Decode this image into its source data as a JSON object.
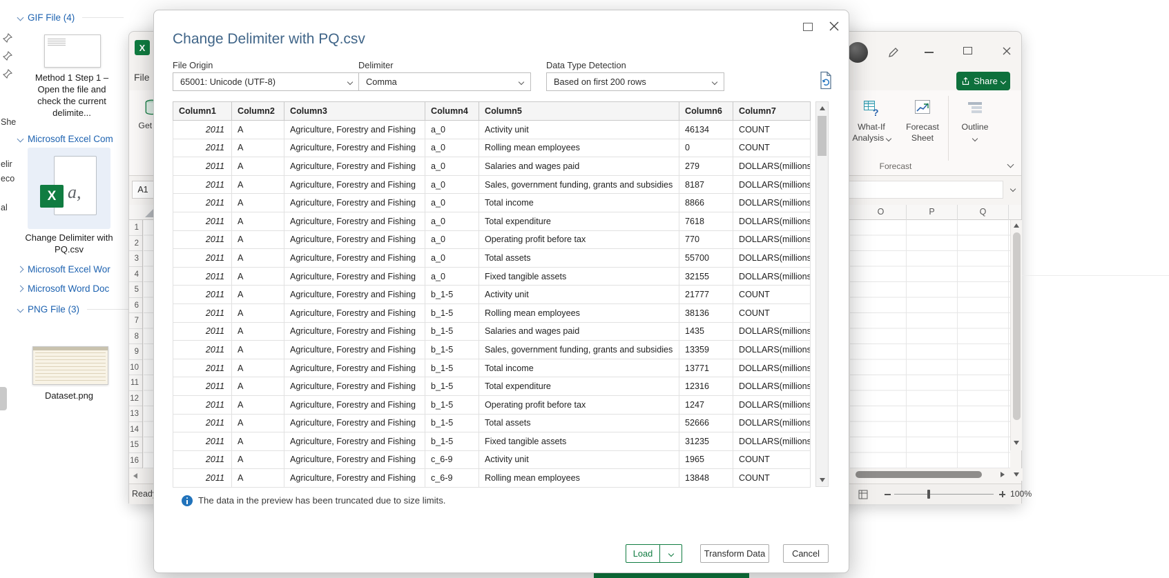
{
  "colors": {
    "excel_green": "#107C41",
    "share_green": "#0E703C",
    "dialog_title_blue": "#406588",
    "info_blue": "#2173BB",
    "explorer_link_blue": "#1D62B0"
  },
  "icon_glyphs": {
    "excel_x": "X",
    "csv_a": "a,"
  },
  "explorer": {
    "rail_fragments": [
      "She",
      "elir",
      "eco",
      "al"
    ],
    "groups": [
      {
        "label": "GIF File (4)",
        "state": "expanded"
      },
      {
        "label": "Microsoft Excel Com",
        "state": "expanded"
      },
      {
        "label": "Microsoft Excel Wor",
        "state": "collapsed"
      },
      {
        "label": "Microsoft Word Doc",
        "state": "collapsed"
      },
      {
        "label": "PNG File (3)",
        "state": "expanded"
      }
    ],
    "items": [
      {
        "name": "Method 1 Step 1 – Open the file and check the current delimite..."
      },
      {
        "name": "Change Delimiter with PQ.csv"
      },
      {
        "name": "Dataset.png"
      }
    ]
  },
  "excel": {
    "file_menu": "File",
    "get_data": "Get Data",
    "name_box": "A1",
    "share": "Share",
    "ribbon": {
      "what_if_1": "What-If",
      "what_if_2": "Analysis",
      "forecast_sheet_1": "Forecast",
      "forecast_sheet_2": "Sheet",
      "outline": "Outline",
      "group_label": "Forecast"
    },
    "column_headers": [
      "O",
      "P",
      "Q"
    ],
    "row_numbers": [
      "1",
      "2",
      "3",
      "4",
      "5",
      "6",
      "7",
      "8",
      "9",
      "10",
      "11",
      "12",
      "13",
      "14",
      "15",
      "16"
    ],
    "status": "Ready",
    "zoom": "100%"
  },
  "dialog": {
    "title": "Change Delimiter with PQ.csv",
    "file_origin": {
      "label": "File Origin",
      "value": "65001: Unicode (UTF-8)"
    },
    "delimiter": {
      "label": "Delimiter",
      "value": "Comma"
    },
    "type_detection": {
      "label": "Data Type Detection",
      "value": "Based on first 200 rows"
    },
    "table": {
      "headers": [
        "Column1",
        "Column2",
        "Column3",
        "Column4",
        "Column5",
        "Column6",
        "Column7"
      ],
      "rows": [
        [
          "2011",
          "A",
          "Agriculture, Forestry and Fishing",
          "a_0",
          "Activity unit",
          "46134",
          "COUNT"
        ],
        [
          "2011",
          "A",
          "Agriculture, Forestry and Fishing",
          "a_0",
          "Rolling mean employees",
          "0",
          "COUNT"
        ],
        [
          "2011",
          "A",
          "Agriculture, Forestry and Fishing",
          "a_0",
          "Salaries and wages paid",
          "279",
          "DOLLARS(millions)"
        ],
        [
          "2011",
          "A",
          "Agriculture, Forestry and Fishing",
          "a_0",
          "Sales, government funding, grants and subsidies",
          "8187",
          "DOLLARS(millions)"
        ],
        [
          "2011",
          "A",
          "Agriculture, Forestry and Fishing",
          "a_0",
          "Total income",
          "8866",
          "DOLLARS(millions)"
        ],
        [
          "2011",
          "A",
          "Agriculture, Forestry and Fishing",
          "a_0",
          "Total expenditure",
          "7618",
          "DOLLARS(millions)"
        ],
        [
          "2011",
          "A",
          "Agriculture, Forestry and Fishing",
          "a_0",
          "Operating profit before tax",
          "770",
          "DOLLARS(millions)"
        ],
        [
          "2011",
          "A",
          "Agriculture, Forestry and Fishing",
          "a_0",
          "Total assets",
          "55700",
          "DOLLARS(millions)"
        ],
        [
          "2011",
          "A",
          "Agriculture, Forestry and Fishing",
          "a_0",
          "Fixed tangible assets",
          "32155",
          "DOLLARS(millions)"
        ],
        [
          "2011",
          "A",
          "Agriculture, Forestry and Fishing",
          "b_1-5",
          "Activity unit",
          "21777",
          "COUNT"
        ],
        [
          "2011",
          "A",
          "Agriculture, Forestry and Fishing",
          "b_1-5",
          "Rolling mean employees",
          "38136",
          "COUNT"
        ],
        [
          "2011",
          "A",
          "Agriculture, Forestry and Fishing",
          "b_1-5",
          "Salaries and wages paid",
          "1435",
          "DOLLARS(millions)"
        ],
        [
          "2011",
          "A",
          "Agriculture, Forestry and Fishing",
          "b_1-5",
          "Sales, government funding, grants and subsidies",
          "13359",
          "DOLLARS(millions)"
        ],
        [
          "2011",
          "A",
          "Agriculture, Forestry and Fishing",
          "b_1-5",
          "Total income",
          "13771",
          "DOLLARS(millions)"
        ],
        [
          "2011",
          "A",
          "Agriculture, Forestry and Fishing",
          "b_1-5",
          "Total expenditure",
          "12316",
          "DOLLARS(millions)"
        ],
        [
          "2011",
          "A",
          "Agriculture, Forestry and Fishing",
          "b_1-5",
          "Operating profit before tax",
          "1247",
          "DOLLARS(millions)"
        ],
        [
          "2011",
          "A",
          "Agriculture, Forestry and Fishing",
          "b_1-5",
          "Total assets",
          "52666",
          "DOLLARS(millions)"
        ],
        [
          "2011",
          "A",
          "Agriculture, Forestry and Fishing",
          "b_1-5",
          "Fixed tangible assets",
          "31235",
          "DOLLARS(millions)"
        ],
        [
          "2011",
          "A",
          "Agriculture, Forestry and Fishing",
          "c_6-9",
          "Activity unit",
          "1965",
          "COUNT"
        ],
        [
          "2011",
          "A",
          "Agriculture, Forestry and Fishing",
          "c_6-9",
          "Rolling mean employees",
          "13848",
          "COUNT"
        ]
      ]
    },
    "truncation_note": "The data in the preview has been truncated due to size limits.",
    "buttons": {
      "load": "Load",
      "transform_data": "Transform Data",
      "cancel": "Cancel"
    }
  }
}
